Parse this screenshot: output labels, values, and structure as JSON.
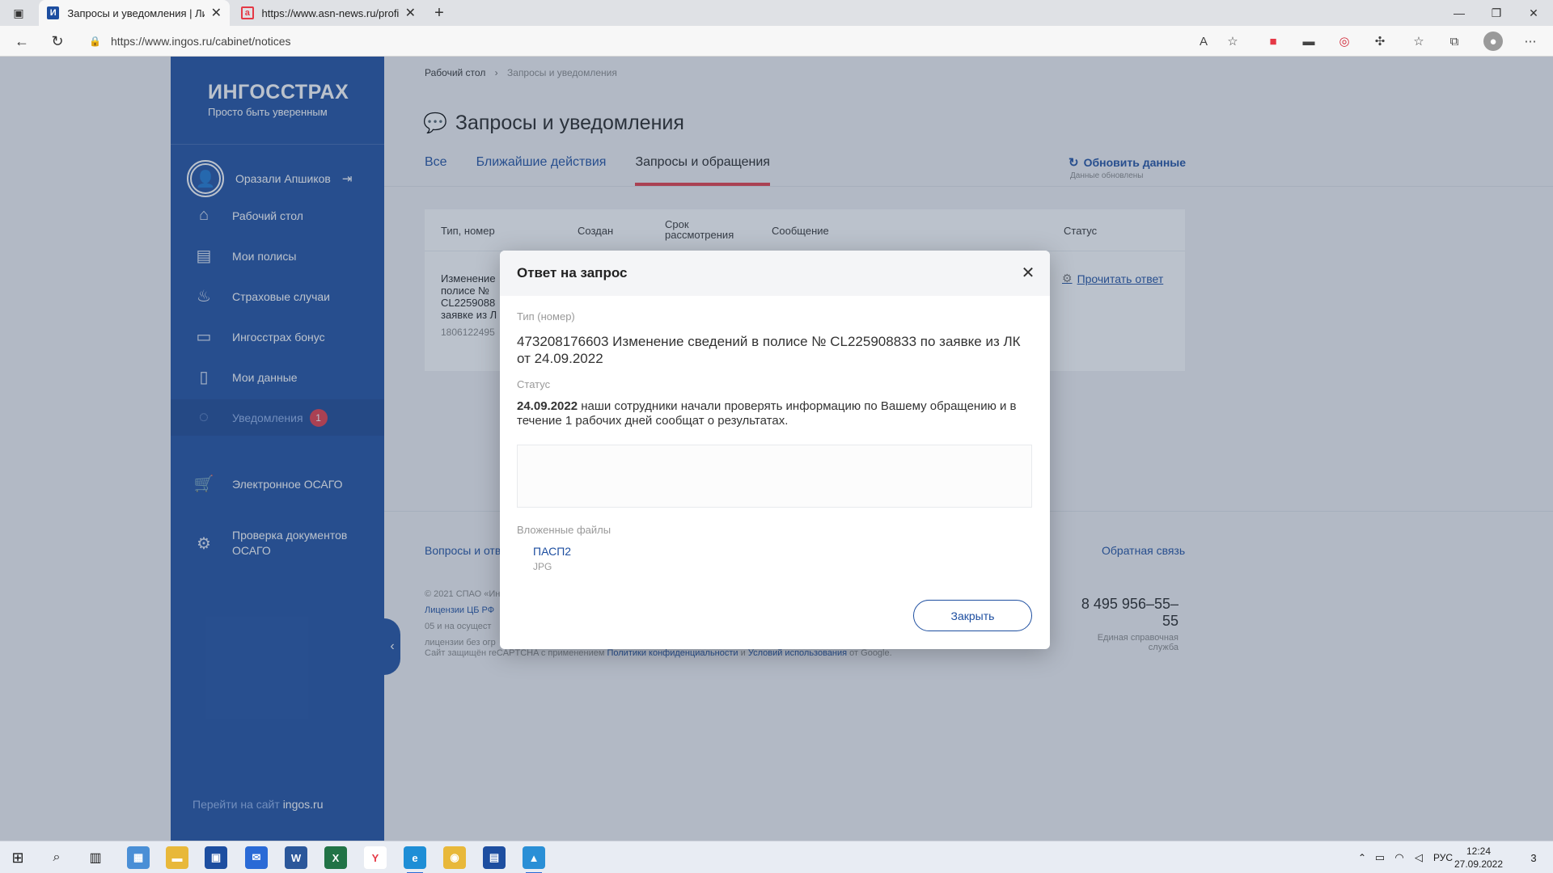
{
  "browser": {
    "tabs": [
      {
        "favicon": "И",
        "title": "Запросы и уведомления | Личн",
        "active": true
      },
      {
        "favicon": "a",
        "title": "https://www.asn-news.ru/profile",
        "active": false
      }
    ],
    "url": "https://www.ingos.ru/cabinet/notices"
  },
  "sidebar": {
    "brand": "ИНГОССТРАХ",
    "tagline": "Просто быть уверенным",
    "user_name": "Оразали Апшиков",
    "items": [
      {
        "label": "Рабочий стол",
        "icon": "home-icon"
      },
      {
        "label": "Мои полисы",
        "icon": "document-icon"
      },
      {
        "label": "Страховые случаи",
        "icon": "fire-icon"
      },
      {
        "label": "Ингосстрах бонус",
        "icon": "card-icon"
      },
      {
        "label": "Мои данные",
        "icon": "profile-doc-icon"
      },
      {
        "label": "Уведомления",
        "icon": "chat-icon",
        "badge": "1",
        "active": true
      },
      {
        "label": "Электронное ОСАГО",
        "icon": "cart-icon"
      },
      {
        "label": "Проверка документов",
        "label_line2": "ОСАГО",
        "icon": "check-docs-icon"
      }
    ],
    "goto_prefix": "Перейти на сайт",
    "goto_domain": "ingos.ru"
  },
  "main": {
    "breadcrumb": {
      "root": "Рабочий стол",
      "current": "Запросы и уведомления"
    },
    "title": "Запросы и уведомления",
    "tabs": [
      {
        "label": "Все"
      },
      {
        "label": "Ближайшие действия"
      },
      {
        "label": "Запросы и обращения",
        "active": true
      }
    ],
    "refresh": {
      "label": "Обновить данные",
      "note": "Данные обновлены"
    },
    "table": {
      "headers": [
        "Тип, номер",
        "Создан",
        "Срок",
        "рассмотрения",
        "Сообщение",
        "Статус"
      ],
      "row": {
        "type_text": "Изменение полисе № CL2259088 заявке из Л",
        "number": "1806122495",
        "action": "Прочитать ответ"
      }
    },
    "footer": {
      "left_link": "Вопросы и отв",
      "feedback": "Обратная связь",
      "copyright_line1": "© 2021 СПАО «Ин",
      "copyright_line2_link": "Лицензии ЦБ РФ",
      "copyright_line3": "05 и на осущест",
      "copyright_line4": "лицензии без огр",
      "phone": "8 495 956–55–55",
      "phone_note": "Единая справочная служба",
      "recaptcha_prefix": "Сайт защищён reCAPTCHA с применением",
      "recaptcha_link1": "Политики конфиденциальности",
      "recaptcha_and": "и",
      "recaptcha_link2": "Условий использования",
      "recaptcha_suffix": "от Google."
    }
  },
  "modal": {
    "title": "Ответ на запрос",
    "type_label": "Тип (номер)",
    "type_value": "473208176603 Изменение сведений в полисе № CL225908833 по заявке из ЛК от 24.09.2022",
    "status_label": "Статус",
    "status_date": "24.09.2022",
    "status_text": "наши сотрудники начали проверять информацию по Вашему обращению и в течение 1 рабочих дней сообщат о результатах.",
    "attachments_label": "Вложенные файлы",
    "attachment_name": "ПАСП2",
    "attachment_ext": "JPG",
    "close_button": "Закрыть"
  },
  "taskbar": {
    "lang": "РУС",
    "time": "12:24",
    "date": "27.09.2022",
    "notifications": "3"
  },
  "colors": {
    "brand_blue": "#1d4ea0",
    "accent_red": "#e53946"
  }
}
